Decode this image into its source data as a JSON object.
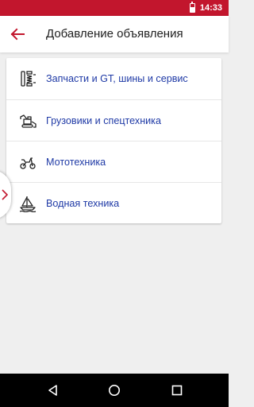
{
  "status_bar": {
    "time": "14:33",
    "background": "#c2162d"
  },
  "header": {
    "back_icon": "arrow-left-icon",
    "title": "Добавление объявления",
    "accent": "#c2162d"
  },
  "categories": [
    {
      "label": "Запчасти и GT, шины и сервис",
      "icon": "shock-absorber-icon"
    },
    {
      "label": "Грузовики и спецтехника",
      "icon": "excavator-icon"
    },
    {
      "label": "Мототехника",
      "icon": "scooter-icon"
    },
    {
      "label": "Водная техника",
      "icon": "sailboat-icon"
    }
  ],
  "side_handle": {
    "icon": "chevron-right-icon"
  },
  "nav_bar": {
    "back_icon": "nav-back-icon",
    "home_icon": "nav-home-icon",
    "recents_icon": "nav-recents-icon"
  },
  "colors": {
    "link": "#1f3aa6",
    "background": "#efefef"
  }
}
